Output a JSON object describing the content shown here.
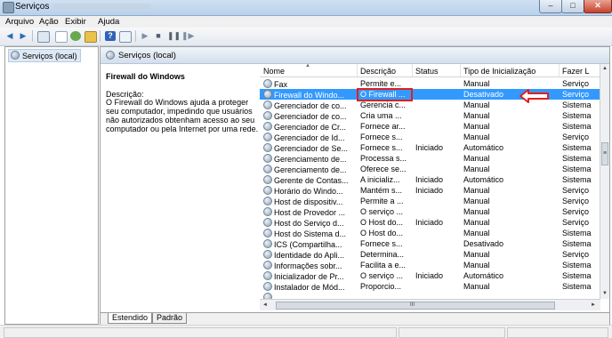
{
  "window": {
    "title": "Serviços",
    "minimize": "–",
    "maximize": "□",
    "close": "✕"
  },
  "menu": [
    "Arquivo",
    "Ação",
    "Exibir",
    "Ajuda"
  ],
  "toolbar": {
    "back": "◀",
    "forward": "▶",
    "help": "?",
    "play": "▶",
    "stop": "■",
    "pause": "❚❚",
    "restart": "❚▶"
  },
  "tree": {
    "root": "Serviços (local)"
  },
  "header": {
    "title": "Serviços (local)"
  },
  "detail": {
    "service_name": "Firewall do Windows",
    "description_label": "Descrição:",
    "description": "O Firewall do Windows ajuda a proteger seu computador, impedindo que usuários não autorizados obtenham acesso ao seu computador ou pela Internet por uma rede."
  },
  "columns": {
    "name": "Nome",
    "description": "Descrição",
    "status": "Status",
    "startup": "Tipo de Inicialização",
    "logon": "Fazer L"
  },
  "services": [
    {
      "name": "Fax",
      "description": "Permite e...",
      "status": "",
      "startup": "Manual",
      "logon": "Serviço"
    },
    {
      "name": "Firewall do Windo...",
      "description": "O Firewall ...",
      "status": "",
      "startup": "Desativado",
      "logon": "Serviço"
    },
    {
      "name": "Gerenciador de co...",
      "description": "Gerencia c...",
      "status": "",
      "startup": "Manual",
      "logon": "Sistema"
    },
    {
      "name": "Gerenciador de co...",
      "description": "Cria uma ...",
      "status": "",
      "startup": "Manual",
      "logon": "Sistema"
    },
    {
      "name": "Gerenciador de Cr...",
      "description": "Fornece ar...",
      "status": "",
      "startup": "Manual",
      "logon": "Sistema"
    },
    {
      "name": "Gerenciador de Id...",
      "description": "Fornece s...",
      "status": "",
      "startup": "Manual",
      "logon": "Serviço"
    },
    {
      "name": "Gerenciador de Se...",
      "description": "Fornece s...",
      "status": "Iniciado",
      "startup": "Automático",
      "logon": "Sistema"
    },
    {
      "name": "Gerenciamento de...",
      "description": "Processa s...",
      "status": "",
      "startup": "Manual",
      "logon": "Sistema"
    },
    {
      "name": "Gerenciamento de...",
      "description": "Oferece se...",
      "status": "",
      "startup": "Manual",
      "logon": "Sistema"
    },
    {
      "name": "Gerente de Contas...",
      "description": "A inicializ...",
      "status": "Iniciado",
      "startup": "Automático",
      "logon": "Sistema"
    },
    {
      "name": "Horário do Windo...",
      "description": "Mantém s...",
      "status": "Iniciado",
      "startup": "Manual",
      "logon": "Serviço"
    },
    {
      "name": "Host de dispositiv...",
      "description": "Permite a ...",
      "status": "",
      "startup": "Manual",
      "logon": "Serviço"
    },
    {
      "name": "Host de Provedor ...",
      "description": "O serviço ...",
      "status": "",
      "startup": "Manual",
      "logon": "Serviço"
    },
    {
      "name": "Host do Serviço d...",
      "description": "O Host do...",
      "status": "Iniciado",
      "startup": "Manual",
      "logon": "Serviço"
    },
    {
      "name": "Host do Sistema d...",
      "description": "O Host do...",
      "status": "",
      "startup": "Manual",
      "logon": "Sistema"
    },
    {
      "name": "ICS (Compartilha...",
      "description": "Fornece s...",
      "status": "",
      "startup": "Desativado",
      "logon": "Sistema"
    },
    {
      "name": "Identidade do Apli...",
      "description": "Determina...",
      "status": "",
      "startup": "Manual",
      "logon": "Serviço"
    },
    {
      "name": "Informações sobr...",
      "description": "Facilita a e...",
      "status": "",
      "startup": "Manual",
      "logon": "Sistema"
    },
    {
      "name": "Inicializador de Pr...",
      "description": "O serviço ...",
      "status": "Iniciado",
      "startup": "Automático",
      "logon": "Sistema"
    },
    {
      "name": "Instalador de Mód...",
      "description": "Proporcio...",
      "status": "",
      "startup": "Manual",
      "logon": "Sistema"
    },
    {
      "name": "",
      "description": "",
      "status": "",
      "startup": "",
      "logon": ""
    }
  ],
  "tabs": [
    "Estendido",
    "Padrão"
  ],
  "colors": {
    "selection": "#3399ff",
    "annotation": "#e02020"
  },
  "scroll_symbols": {
    "up": "▲",
    "down": "▼",
    "left": "◄",
    "right": "►",
    "grip": "≡",
    "hgrip": "III"
  }
}
